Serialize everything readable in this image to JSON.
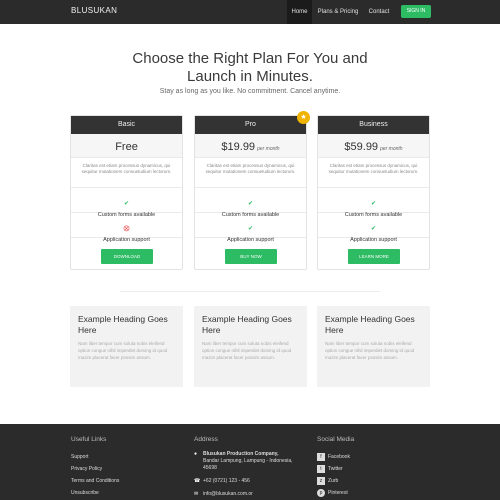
{
  "brand": "BLUSUKAN",
  "nav": {
    "items": [
      {
        "label": "Home"
      },
      {
        "label": "Plans & Pricing"
      },
      {
        "label": "Contact"
      }
    ],
    "signin": "SIGN IN"
  },
  "hero": {
    "title_line1": "Choose the Right Plan For You and",
    "title_line2": "Launch in Minutes.",
    "subtitle": "Stay as long as you like. No commitment. Cancel anytime."
  },
  "plans": [
    {
      "name": "Basic",
      "price": "Free",
      "per": "",
      "desc": "Claritas est etiam processus dynamicus, qui sequitur mutationem consuetudium lectorum.",
      "feature1": "Custom forms available",
      "feature1_ok": true,
      "feature2": "Application support",
      "feature2_ok": false,
      "button": "DOWNLOAD"
    },
    {
      "name": "Pro",
      "price": "$19.99",
      "per": "per month",
      "desc": "Claritas est etiam processus dynamicus, qui sequitur mutationem consuetudium lectorum.",
      "feature1": "Custom forms available",
      "feature1_ok": true,
      "feature2": "Application support",
      "feature2_ok": true,
      "button": "BUY NOW"
    },
    {
      "name": "Business",
      "price": "$59.99",
      "per": "per month",
      "desc": "Claritas est etiam processus dynamicus, qui sequitur mutationem consuetudium lectorum.",
      "feature1": "Custom forms available",
      "feature1_ok": true,
      "feature2": "Application support",
      "feature2_ok": true,
      "button": "LEARN MORE"
    }
  ],
  "cards": [
    {
      "title": "Example Heading Goes Here",
      "body": "Nam liber tempor cum soluta nobis eleifend option congue nihil imperdiet doming id quod mazim placerat facer possim assum."
    },
    {
      "title": "Example Heading Goes Here",
      "body": "Nam liber tempor cum soluta nobis eleifend option congue nihil imperdiet doming id quod mazim placerat facer possim assum."
    },
    {
      "title": "Example Heading Goes Here",
      "body": "Nam liber tempor cum soluta nobis eleifend option congue nihil imperdiet doming id quod mazim placerat facer possim assum."
    }
  ],
  "footer": {
    "links_heading": "Useful Links",
    "links": [
      "Support",
      "Privacy Policy",
      "Terms and Conditions",
      "Unsubscribe"
    ],
    "address_heading": "Address",
    "company": "Blusukan Production Company,",
    "street": "Bandar Lampung, Lampung - Indonesia,",
    "zip": "45698",
    "phone": "+62 (0721) 123 - 456",
    "email": "info@blusukan.com.or",
    "social_heading": "Social Media",
    "social": [
      "Facebook",
      "Twitter",
      "Zurb",
      "Pinterest"
    ]
  },
  "colors": {
    "accent": "#2dbb63",
    "navbar": "#2b2b2b",
    "badge": "#f0b400",
    "error": "#e23a3a"
  }
}
